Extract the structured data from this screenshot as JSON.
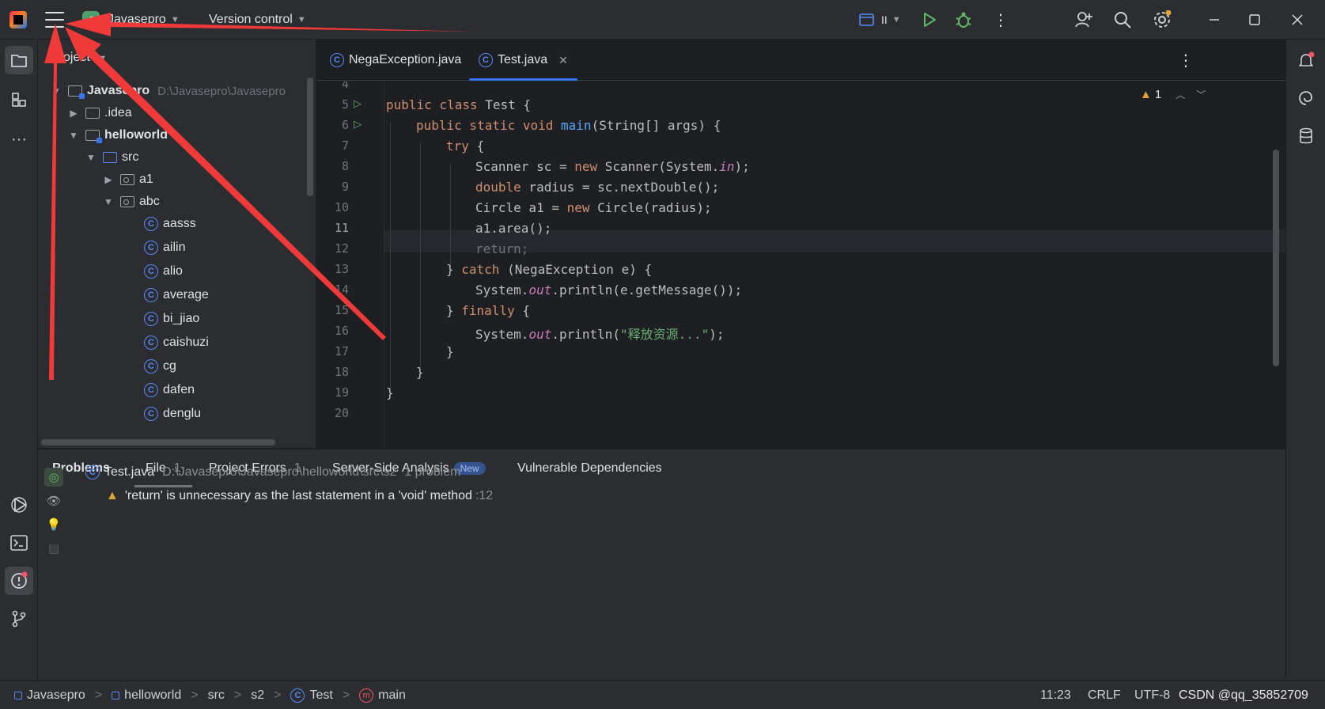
{
  "titlebar": {
    "project_badge": "J",
    "project_name": "Javasepro",
    "vcs": "Version control",
    "run_config": "II"
  },
  "project_panel": {
    "header": "Project",
    "root": {
      "name": "Javasepro",
      "path": "D:\\Javasepro\\Javasepro"
    },
    "items": {
      "idea": ".idea",
      "helloworld": "helloworld",
      "src": "src",
      "a1": "a1",
      "abc": "abc"
    },
    "classes": [
      "aasss",
      "ailin",
      "alio",
      "average",
      "bi_jiao",
      "caishuzi",
      "cg",
      "dafen",
      "denglu"
    ]
  },
  "editor": {
    "tabs": [
      {
        "label": "NegaException.java"
      },
      {
        "label": "Test.java"
      }
    ],
    "warning_count": "1",
    "line_numbers": [
      "4",
      "5",
      "6",
      "7",
      "8",
      "9",
      "10",
      "11",
      "12",
      "13",
      "14",
      "15",
      "16",
      "17",
      "18",
      "19",
      "20"
    ],
    "code": {
      "l5_kw": "public class ",
      "l5_rest": "Test {",
      "l6_kw": "public static void ",
      "l6_fn": "main",
      "l6_rest": "(String[] args) {",
      "l7_kw": "try",
      "l7_rest": " {",
      "l8_a": "Scanner sc = ",
      "l8_kw": "new",
      "l8_b": " Scanner(System.",
      "l8_st": "in",
      "l8_c": ");",
      "l9_kw": "double",
      "l9_rest": " radius = sc.nextDouble();",
      "l10_a": "Circle a1 = ",
      "l10_kw": "new",
      "l10_b": " Circle(radius);",
      "l11": "a1.area();",
      "l12": "return;",
      "l13_a": "} ",
      "l13_kw": "catch",
      "l13_b": " (NegaException e) {",
      "l14_a": "System.",
      "l14_st": "out",
      "l14_b": ".println(e.getMessage());",
      "l15_a": "} ",
      "l15_kw": "finally",
      "l15_b": " {",
      "l16_a": "System.",
      "l16_st": "out",
      "l16_b": ".println(",
      "l16_str": "\"释放资源...\"",
      "l16_c": ");",
      "l17": "}",
      "l18": "}",
      "l19": "}"
    }
  },
  "problems": {
    "tabs": {
      "problems": "Problems",
      "file": "File",
      "file_count": "1",
      "project_errors": "Project Errors",
      "project_errors_count": "1",
      "server_side": "Server-Side Analysis",
      "new_badge": "New",
      "vuln": "Vulnerable Dependencies"
    },
    "file_entry": {
      "name": "Test.java",
      "path": "D:\\Javasepro\\Javasepro\\helloworld\\src\\s2",
      "count": "1 problem"
    },
    "warning": {
      "message": "'return' is unnecessary as the last statement in a 'void' method",
      "line": ":12"
    }
  },
  "statusbar": {
    "crumbs": [
      "Javasepro",
      "helloworld",
      "src",
      "s2",
      "Test",
      "main"
    ],
    "position": "11:23",
    "line_sep": "CRLF",
    "encoding": "UTF-8",
    "watermark": "CSDN @qq_35852709"
  },
  "colors": {
    "accent": "#3574f0",
    "keyword": "#cf8e6d",
    "function": "#56a8f5",
    "static_field": "#c77dbb",
    "string": "#6aab73",
    "warning": "#e0a436",
    "annotation_arrow": "#f03a3a"
  }
}
